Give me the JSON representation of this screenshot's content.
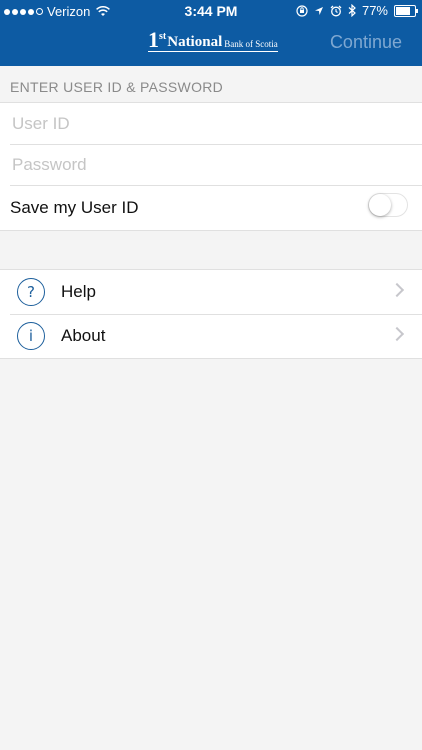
{
  "status_bar": {
    "carrier": "Verizon",
    "time": "3:44 PM",
    "battery": "77%",
    "battery_level": 0.77,
    "icons": [
      "signal-dots-icon",
      "wifi-icon",
      "orientation-lock-icon",
      "location-icon",
      "alarm-icon",
      "bluetooth-icon",
      "battery-icon"
    ]
  },
  "header": {
    "logo_number": "1",
    "logo_superscript": "st",
    "logo_main": "National",
    "logo_rest": "Bank of Scotia",
    "continue_label": "Continue",
    "background_color": "#0d5ba3"
  },
  "login": {
    "section_title": "ENTER USER ID & PASSWORD",
    "user_id_placeholder": "User ID",
    "user_id_value": "",
    "password_placeholder": "Password",
    "password_value": "",
    "save_user_id_label": "Save my User ID",
    "save_user_id_on": false
  },
  "menu": {
    "items": [
      {
        "label": "Help",
        "icon": "help-icon",
        "glyph": "?"
      },
      {
        "label": "About",
        "icon": "info-icon",
        "glyph": "i"
      }
    ]
  }
}
